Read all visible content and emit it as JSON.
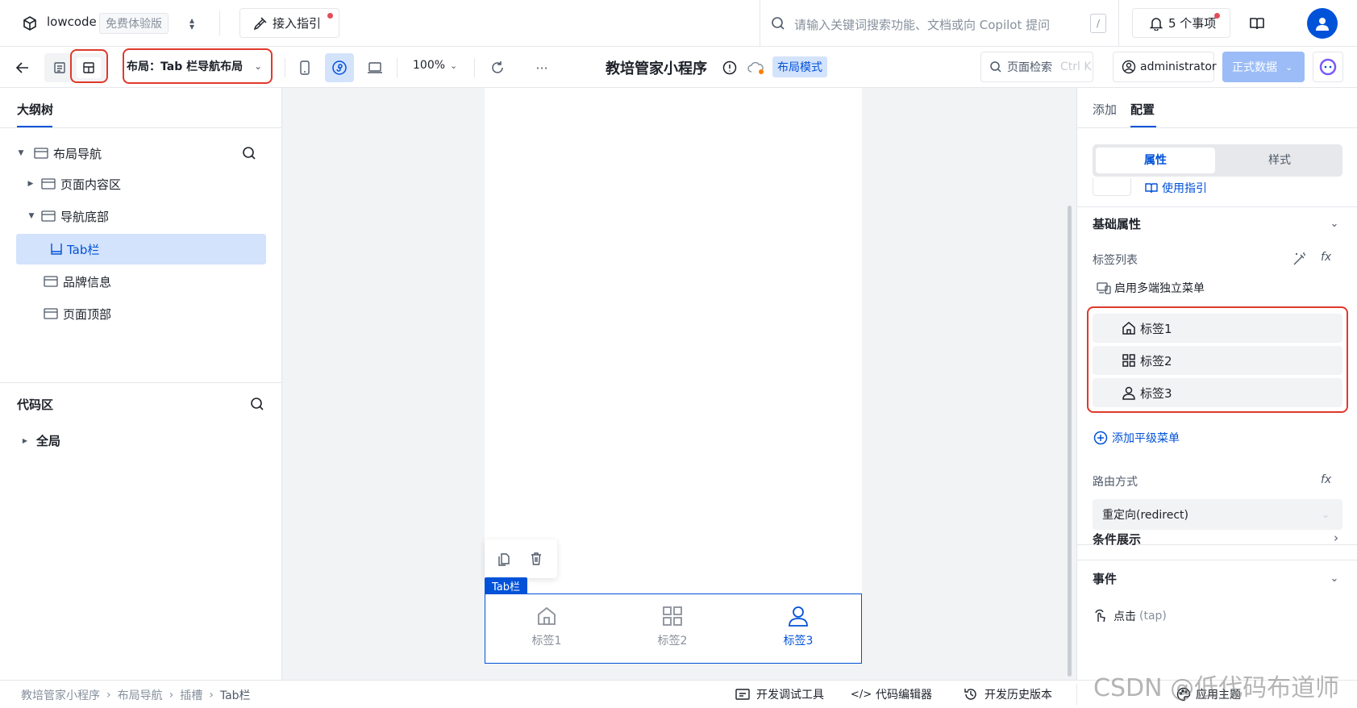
{
  "topbar": {
    "app_name": "lowcode",
    "edition_badge": "免费体验版",
    "guide_label": "接入指引",
    "search_placeholder": "请输入关键词搜索功能、文档或向 Copilot 提问",
    "search_shortcut": "/",
    "todo_label": "5 个事项"
  },
  "toolbar": {
    "layout_select": "布局：Tab 栏导航布局",
    "zoom": "100%",
    "app_title": "教培管家小程序",
    "mode_badge": "布局模式",
    "page_search": "页面检索",
    "page_search_shortcut": "Ctrl K",
    "user": "administrator",
    "data_env": "正式数据"
  },
  "left": {
    "outline_title": "大纲树",
    "tree": [
      {
        "label": "布局导航"
      },
      {
        "label": "页面内容区"
      },
      {
        "label": "导航底部"
      },
      {
        "label": "Tab栏"
      },
      {
        "label": "品牌信息"
      },
      {
        "label": "页面顶部"
      }
    ],
    "code_title": "代码区",
    "code_item": "全局"
  },
  "canvas": {
    "component_tag": "Tab栏",
    "tabs": [
      {
        "label": "标签1",
        "icon": "home-icon"
      },
      {
        "label": "标签2",
        "icon": "grid-icon"
      },
      {
        "label": "标签3",
        "icon": "user-icon"
      }
    ]
  },
  "right": {
    "tab_add": "添加",
    "tab_config": "配置",
    "seg_props": "属性",
    "seg_style": "样式",
    "usage_guide": "使用指引",
    "basic_section": "基础属性",
    "tab_list_label": "标签列表",
    "multi_menu": "启用多端独立菜单",
    "tab_items": [
      {
        "label": "标签1",
        "icon": "home-icon"
      },
      {
        "label": "标签2",
        "icon": "grid-icon"
      },
      {
        "label": "标签3",
        "icon": "user-icon"
      }
    ],
    "add_menu": "添加平级菜单",
    "routing_label": "路由方式",
    "routing_value": "重定向(redirect)",
    "cond_section": "条件展示",
    "event_section": "事件",
    "event_click": "点击",
    "event_click_code": "(tap)",
    "fx": "fx"
  },
  "statusbar": {
    "breadcrumb": [
      "教培管家小程序",
      "布局导航",
      "插槽",
      "Tab栏"
    ],
    "devtools": "开发调试工具",
    "code_editor": "代码编辑器",
    "history": "开发历史版本",
    "theme": "应用主题",
    "watermark": "CSDN @低代码布道师"
  },
  "colors": {
    "accent": "#0052d9",
    "selected_bg": "#d4e3fc",
    "highlight": "#e0392b"
  }
}
